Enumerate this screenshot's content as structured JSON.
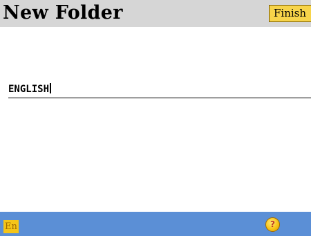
{
  "header": {
    "title": "New Folder",
    "finish_label": "Finish"
  },
  "form": {
    "folder_name_value": "ENGLISH"
  },
  "status_bar": {
    "input_language": "En",
    "help_icon": "help-icon",
    "help_glyph": "?"
  },
  "colors": {
    "title_bar": "#d6d6d6",
    "status_bar": "#5b8fd6",
    "accent": "#f7d44a"
  }
}
